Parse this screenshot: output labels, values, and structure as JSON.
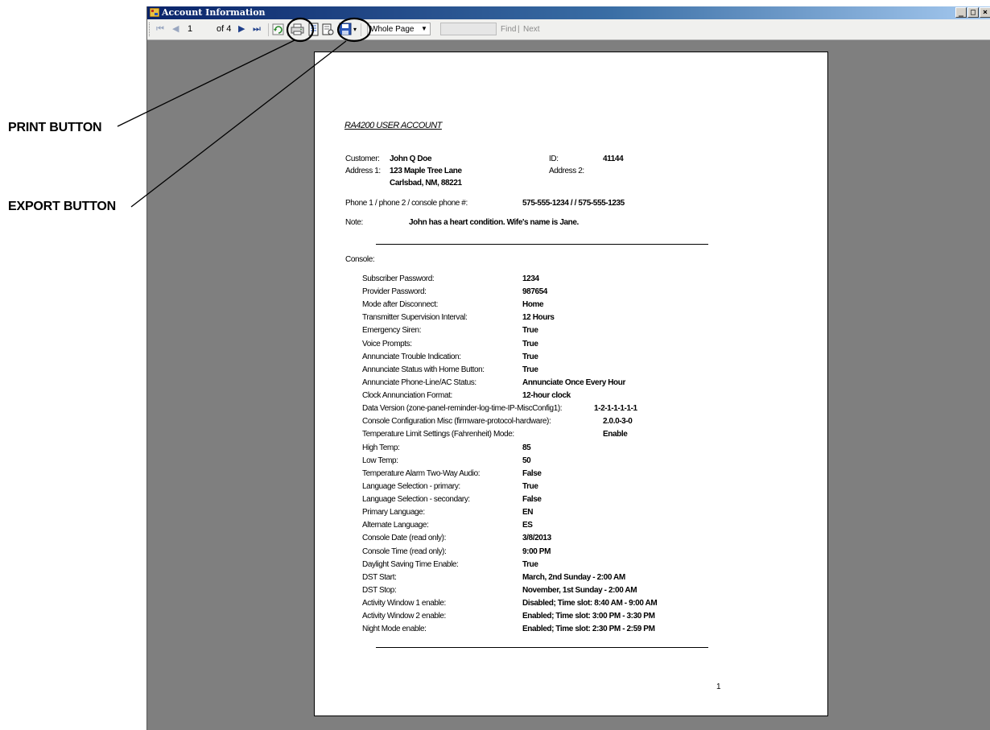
{
  "callouts": {
    "print": "PRINT BUTTON",
    "export": "EXPORT BUTTON"
  },
  "window": {
    "title": "Account Information",
    "minimize": "_",
    "maximize": "□",
    "close": "×"
  },
  "toolbar": {
    "first_icon": "⏮",
    "prev_icon": "◀",
    "current_page": "1",
    "of_pages": "of 4",
    "next_icon": "▶",
    "last_icon": "⏭",
    "zoom": "Whole Page",
    "find_value": "",
    "find": "Find",
    "find_sep": "|",
    "next": "Next",
    "icons": [
      "refresh-icon",
      "print-icon",
      "print-layout-icon",
      "page-setup-icon",
      "export-save-icon"
    ]
  },
  "report": {
    "title": "RA4200 USER ACCOUNT",
    "header": {
      "customer_label": "Customer:",
      "customer": "John Q Doe",
      "id_label": "ID:",
      "id": "41144",
      "address1_label": "Address 1:",
      "address1_line1": "123 Maple Tree Lane",
      "address1_line2": "Carlsbad, NM, 88221",
      "address2_label": "Address 2:",
      "address2": "",
      "phone_label": "Phone 1 / phone 2 / console phone #:",
      "phone": "575-555-1234 /  / 575-555-1235",
      "note_label": "Note:",
      "note": "John has a heart condition. Wife's name is Jane."
    },
    "section": "Console:",
    "rows": [
      {
        "label": "Subscriber Password:",
        "value": "1234"
      },
      {
        "label": "Provider Password:",
        "value": "987654"
      },
      {
        "label": "Mode after Disconnect:",
        "value": "Home"
      },
      {
        "label": "Transmitter Supervision Interval:",
        "value": "12 Hours"
      },
      {
        "label": "Emergency Siren:",
        "value": "True"
      },
      {
        "label": "Voice Prompts:",
        "value": "True"
      },
      {
        "label": "Annunciate Trouble Indication:",
        "value": "True"
      },
      {
        "label": "Annunciate Status with Home Button:",
        "value": "True"
      },
      {
        "label": "Annunciate Phone-Line/AC Status:",
        "value": "Annunciate Once Every Hour"
      },
      {
        "label": "Clock Annunciation Format:",
        "value": "12-hour clock"
      },
      {
        "label": "Data Version (zone-panel-reminder-log-time-IP-MiscConfig1):",
        "value": "1-2-1-1-1-1-1"
      },
      {
        "label": "Console Configuration Misc (firmware-protocol-hardware):",
        "value": "2.0.0-3-0"
      },
      {
        "label": "Temperature Limit Settings (Fahrenheit) Mode:",
        "value": "Enable"
      },
      {
        "label": "High Temp:",
        "value": "85"
      },
      {
        "label": "Low Temp:",
        "value": "50"
      },
      {
        "label": "Temperature Alarm Two-Way Audio:",
        "value": "False"
      },
      {
        "label": "Language Selection - primary:",
        "value": "True"
      },
      {
        "label": "Language Selection - secondary:",
        "value": "False"
      },
      {
        "label": "Primary Language:",
        "value": "EN"
      },
      {
        "label": "Alternate Language:",
        "value": "ES"
      },
      {
        "label": "Console Date (read only):",
        "value": "3/8/2013"
      },
      {
        "label": "Console Time (read only):",
        "value": "9:00 PM"
      },
      {
        "label": "Daylight Saving Time Enable:",
        "value": "True"
      },
      {
        "label": "DST Start:",
        "value": "March, 2nd Sunday - 2:00 AM"
      },
      {
        "label": "DST Stop:",
        "value": "November, 1st Sunday - 2:00 AM"
      },
      {
        "label": "Activity Window 1 enable:",
        "value": "Disabled; Time slot: 8:40 AM - 9:00 AM"
      },
      {
        "label": "Activity Window 2 enable:",
        "value": "Enabled; Time slot: 3:00 PM - 3:30 PM"
      },
      {
        "label": "Night Mode enable:",
        "value": "Enabled; Time slot: 2:30 PM - 2:59 PM"
      }
    ],
    "page_number": "1"
  }
}
